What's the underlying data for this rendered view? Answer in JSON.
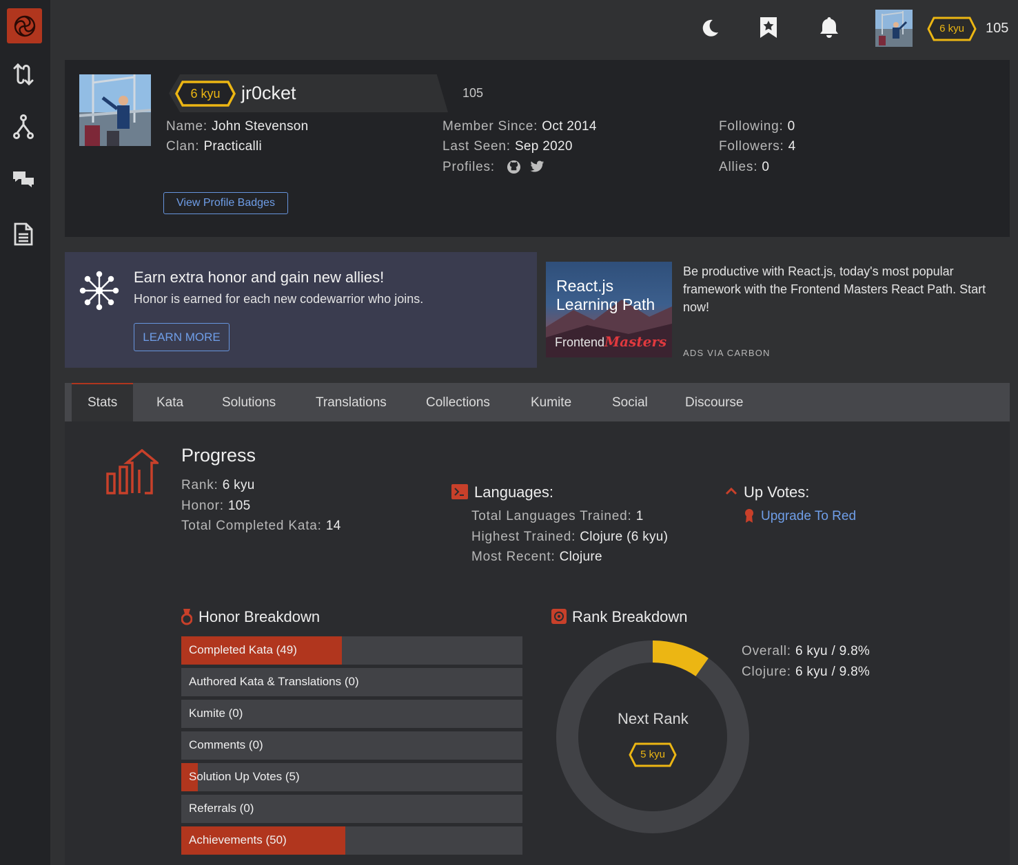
{
  "topbar": {
    "rank": "6 kyu",
    "honor": "105"
  },
  "profile": {
    "rank": "6 kyu",
    "username": "jr0cket",
    "honor": "105",
    "name_label": "Name:",
    "name": "John Stevenson",
    "clan_label": "Clan:",
    "clan": "Practicalli",
    "member_since_label": "Member Since:",
    "member_since": "Oct 2014",
    "last_seen_label": "Last Seen:",
    "last_seen": "Sep 2020",
    "profiles_label": "Profiles:",
    "following_label": "Following:",
    "following": "0",
    "followers_label": "Followers:",
    "followers": "4",
    "allies_label": "Allies:",
    "allies": "0",
    "badges_button": "View Profile Badges"
  },
  "promo": {
    "title": "Earn extra honor and gain new allies!",
    "text": "Honor is earned for each new codewarrior who joins.",
    "button": "LEARN MORE"
  },
  "ad": {
    "image_title_line1": "React.js",
    "image_title_line2": "Learning Path",
    "image_brand_a": "Frontend",
    "image_brand_b": "Masters",
    "text": "Be productive with React.js, today's most popular framework with the Frontend Masters React Path. Start now!",
    "via": "ADS VIA CARBON"
  },
  "tabs": [
    "Stats",
    "Kata",
    "Solutions",
    "Translations",
    "Collections",
    "Kumite",
    "Social",
    "Discourse"
  ],
  "progress": {
    "title": "Progress",
    "rank_label": "Rank:",
    "rank": "6 kyu",
    "honor_label": "Honor:",
    "honor": "105",
    "completed_label": "Total Completed Kata:",
    "completed": "14"
  },
  "languages": {
    "title": "Languages:",
    "trained_label": "Total Languages Trained:",
    "trained": "1",
    "highest_label": "Highest Trained:",
    "highest": "Clojure (6 kyu)",
    "recent_label": "Most Recent:",
    "recent": "Clojure"
  },
  "upvotes": {
    "title": "Up Votes:",
    "link": "Upgrade To Red"
  },
  "honor_breakdown": {
    "title": "Honor Breakdown",
    "bars": [
      {
        "label": "Completed Kata (49)",
        "fill": 0.47
      },
      {
        "label": "Authored Kata & Translations (0)",
        "fill": 0
      },
      {
        "label": "Kumite (0)",
        "fill": 0
      },
      {
        "label": "Comments (0)",
        "fill": 0
      },
      {
        "label": "Solution Up Votes (5)",
        "fill": 0.048
      },
      {
        "label": "Referrals (0)",
        "fill": 0
      },
      {
        "label": "Achievements (50)",
        "fill": 0.48
      }
    ]
  },
  "rank_breakdown": {
    "title": "Rank Breakdown",
    "overall_label": "Overall:",
    "overall": "6 kyu / 9.8%",
    "clojure_label": "Clojure:",
    "clojure": "6 kyu / 9.8%",
    "progress_fraction": 0.098,
    "next_rank_label": "Next Rank",
    "next_rank": "5 kyu"
  },
  "colors": {
    "accent": "#b1361e",
    "kyu_yellow": "#ecb613",
    "link": "#6f9ee8"
  }
}
